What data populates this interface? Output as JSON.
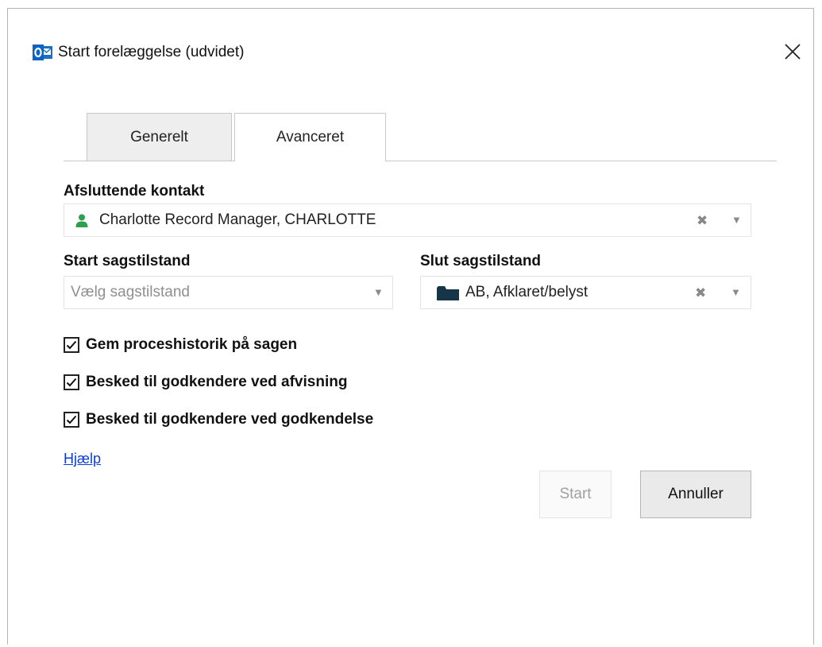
{
  "window": {
    "title": "Start forelæggelse (udvidet)",
    "app_icon": "outlook-icon",
    "close_icon": "close-icon"
  },
  "tabs": [
    {
      "label": "Generelt",
      "active": false
    },
    {
      "label": "Avanceret",
      "active": true
    }
  ],
  "closing_contact": {
    "label": "Afsluttende kontakt",
    "value": "Charlotte Record Manager, CHARLOTTE",
    "icon": "person-icon",
    "icon_color": "#2e9e4f",
    "clear_glyph": "✖",
    "caret_glyph": "▼"
  },
  "start_state": {
    "label": "Start sagstilstand",
    "placeholder": "Vælg sagstilstand",
    "caret_glyph": "▼"
  },
  "end_state": {
    "label": "Slut sagstilstand",
    "value": "AB, Afklaret/belyst",
    "icon": "folder-icon",
    "icon_color": "#173549",
    "clear_glyph": "✖",
    "caret_glyph": "▼"
  },
  "options": [
    {
      "label": "Gem proceshistorik på sagen",
      "checked": true
    },
    {
      "label": "Besked til godkendere ved afvisning",
      "checked": true
    },
    {
      "label": "Besked til godkendere ved godkendelse",
      "checked": true
    }
  ],
  "help_link": "Hjælp",
  "buttons": {
    "start": "Start",
    "start_enabled": false,
    "cancel": "Annuller"
  },
  "colors": {
    "link": "#0b3dd4",
    "border": "#c8c8c8"
  }
}
